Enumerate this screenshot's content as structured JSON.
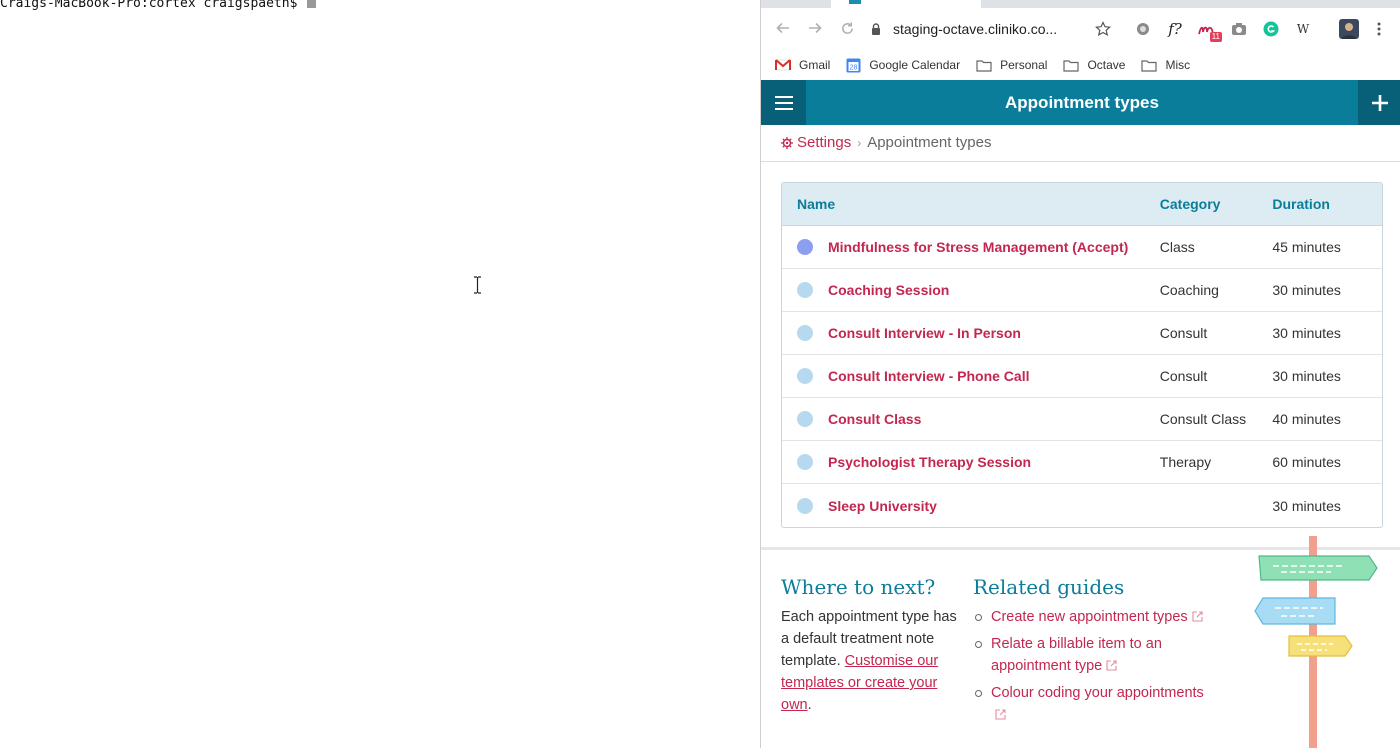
{
  "terminal": {
    "prompt": "Craigs-MacBook-Pro:cortex craigspaeth$"
  },
  "browser": {
    "url": "staging-octave.cliniko.co...",
    "bookmarks": [
      {
        "label": "Gmail",
        "icon": "gmail-icon"
      },
      {
        "label": "Google Calendar",
        "icon": "calendar-icon"
      },
      {
        "label": "Personal",
        "icon": "folder-icon"
      },
      {
        "label": "Octave",
        "icon": "folder-icon"
      },
      {
        "label": "Misc",
        "icon": "folder-icon"
      }
    ],
    "calendar_day": "28",
    "ext_badge_count": "11",
    "ext_f_label": "f?",
    "ext_w_label": "W"
  },
  "app": {
    "title": "Appointment types",
    "breadcrumb": {
      "settings": "Settings",
      "current": "Appointment types"
    },
    "table": {
      "columns": [
        "Name",
        "Category",
        "Duration"
      ],
      "rows": [
        {
          "name": "Mindfulness for Stress Management (Accept)",
          "category": "Class",
          "duration": "45 minutes",
          "color": "#8c9ef0"
        },
        {
          "name": "Coaching Session",
          "category": "Coaching",
          "duration": "30 minutes",
          "color": "#b7d9ef"
        },
        {
          "name": "Consult Interview - In Person",
          "category": "Consult",
          "duration": "30 minutes",
          "color": "#b7d9ef"
        },
        {
          "name": "Consult Interview - Phone Call",
          "category": "Consult",
          "duration": "30 minutes",
          "color": "#b7d9ef"
        },
        {
          "name": "Consult Class",
          "category": "Consult Class",
          "duration": "40 minutes",
          "color": "#b7d9ef"
        },
        {
          "name": "Psychologist Therapy Session",
          "category": "Therapy",
          "duration": "60 minutes",
          "color": "#b7d9ef"
        },
        {
          "name": "Sleep University",
          "category": "",
          "duration": "30 minutes",
          "color": "#b7d9ef"
        }
      ]
    },
    "where_next": {
      "title": "Where to next?",
      "text_before": "Each appointment type has a default treatment note template. ",
      "link": "Customise our templates or create your own",
      "text_after": "."
    },
    "related_guides": {
      "title": "Related guides",
      "items": [
        "Create new appointment types",
        "Relate a billable item to an appointment type",
        "Colour coding your appointments"
      ]
    }
  },
  "colors": {
    "brand": "#0a7d9a",
    "brand_dark": "#075f78",
    "link": "#c3274f"
  }
}
